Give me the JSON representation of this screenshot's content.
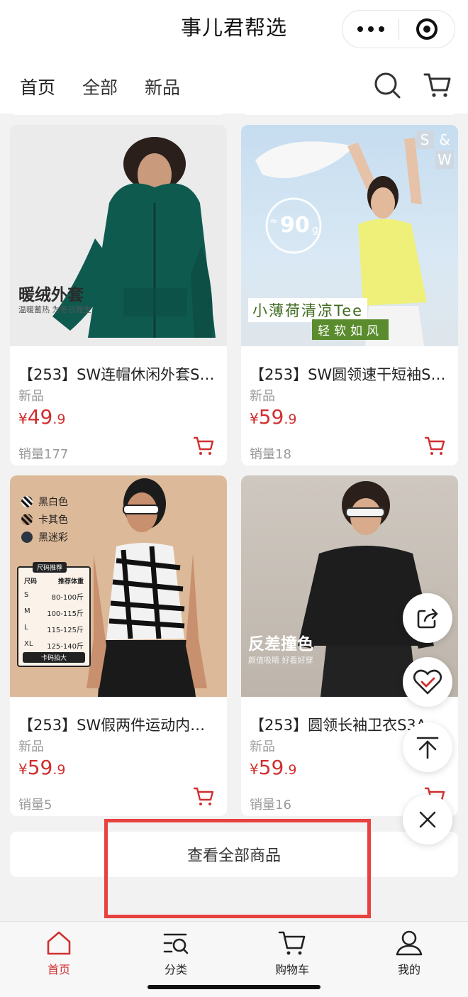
{
  "app": {
    "title": "事儿君帮选"
  },
  "tabs": [
    {
      "label": "首页",
      "active": true
    },
    {
      "label": "全部",
      "active": false
    },
    {
      "label": "新品",
      "active": false
    }
  ],
  "products": [
    {
      "name": "【253】SW连帽休闲外套S…",
      "tag": "新品",
      "currency": "¥",
      "price_int": "49",
      "price_dec": ".9",
      "sales": "销量177",
      "image_text": {
        "headline": "暖绒外套",
        "subline": "温暖蓄热 为冬日而生"
      }
    },
    {
      "name": "【253】SW圆领速干短袖S…",
      "tag": "新品",
      "currency": "¥",
      "price_int": "59",
      "price_dec": ".9",
      "sales": "销量18",
      "image_text": {
        "logo_s": "S",
        "logo_amp": "&",
        "logo_w": "W",
        "weight": "90",
        "weight_unit": "g",
        "weight_prefix": "≈",
        "headline": "小薄荷清凉Tee",
        "subline": "轻软如风"
      }
    },
    {
      "name": "【253】SW假两件运动内…",
      "tag": "新品",
      "currency": "¥",
      "price_int": "59",
      "price_dec": ".9",
      "sales": "销量5",
      "image_text": {
        "colors": [
          "黑白色",
          "卡其色",
          "黑迷彩"
        ],
        "size_title": "尺码推荐",
        "size_head": [
          "尺码",
          "推荐体重"
        ],
        "size_rows": [
          [
            "S",
            "80-100斤"
          ],
          [
            "M",
            "100-115斤"
          ],
          [
            "L",
            "115-125斤"
          ],
          [
            "XL",
            "125-140斤"
          ]
        ],
        "size_foot": "卡码拍大"
      }
    },
    {
      "name": "【253】圆领长袖卫衣S3A…",
      "tag": "新品",
      "currency": "¥",
      "price_int": "59",
      "price_dec": ".9",
      "sales": "销量16",
      "image_text": {
        "headline": "反差撞色",
        "subline": "颜值吸睛 好看好穿"
      }
    }
  ],
  "view_all": "查看全部商品",
  "bottom_nav": [
    {
      "label": "首页",
      "icon": "home-icon",
      "active": true
    },
    {
      "label": "分类",
      "icon": "category-icon",
      "active": false
    },
    {
      "label": "购物车",
      "icon": "cart-icon",
      "active": false
    },
    {
      "label": "我的",
      "icon": "profile-icon",
      "active": false
    }
  ],
  "colors": {
    "accent": "#d0302f",
    "highlight": "#e8413f"
  }
}
